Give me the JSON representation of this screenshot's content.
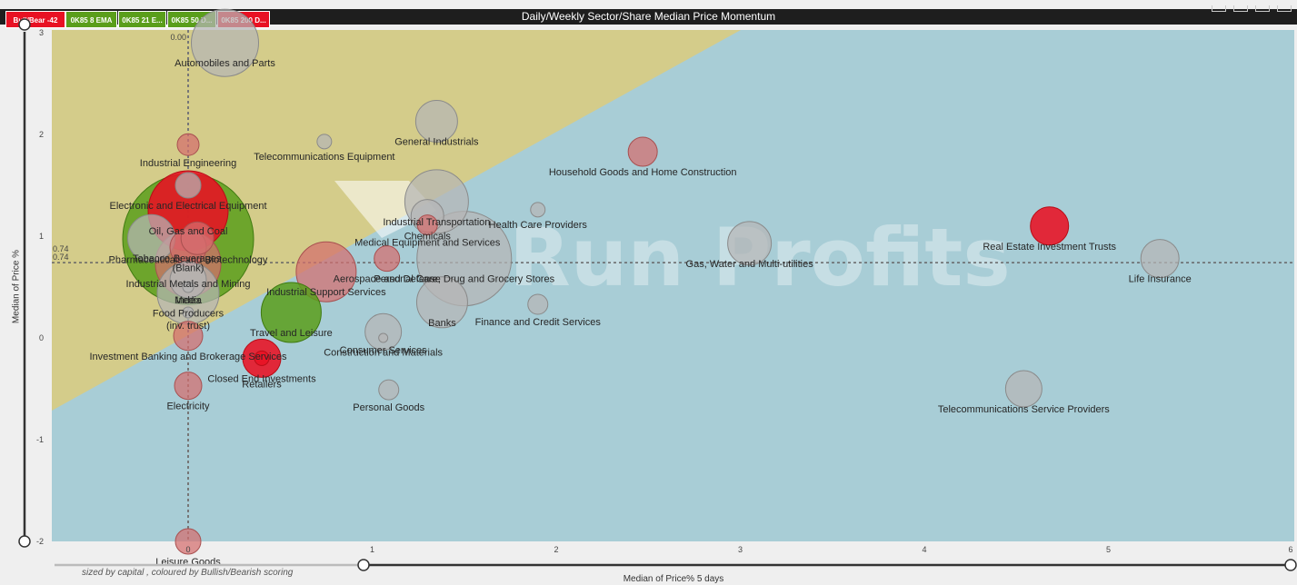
{
  "title": "Daily/Weekly Sector/Share Median Price Momentum",
  "badges": [
    {
      "label": "Bull/Bear -42",
      "color": "#e81123"
    },
    {
      "label": "0K85 8 EMA",
      "color": "#5a9e1b"
    },
    {
      "label": "0K85 21 E...",
      "color": "#5a9e1b"
    },
    {
      "label": "0K85 50 D...",
      "color": "#5a9e1b"
    },
    {
      "label": "0K85 200 D...",
      "color": "#e81123"
    }
  ],
  "caption": "sized by capital , coloured by Bullish/Bearish scoring",
  "watermark": "Run Profits",
  "colors": {
    "bullish": "#e81123",
    "bearish_fill": "#d46d6d",
    "neutral": "#b5b5b5",
    "green": "#5a9e1b",
    "bg_teal": "#a8cdd6",
    "bg_yellow": "#d4cc8a"
  },
  "chart_data": {
    "type": "scatter",
    "title": "Daily/Weekly Sector/Share Median Price Momentum",
    "xlabel": "Median of Price% 5 days",
    "ylabel": "Median of Price %",
    "xlim": [
      -0.7,
      6
    ],
    "ylim": [
      -2,
      3
    ],
    "xticks": [
      0,
      1,
      2,
      3,
      4,
      5,
      6
    ],
    "yticks": [
      -2,
      -1,
      0,
      1,
      2,
      3
    ],
    "reference_lines": {
      "x": 0,
      "y": 0.74,
      "y_labels": [
        "0.74",
        "0.74"
      ],
      "x_label": "0.00"
    },
    "grid": false,
    "points": [
      {
        "name": "Automobiles and Parts",
        "x": 0.2,
        "y": 2.9,
        "size": 37,
        "color": "grey"
      },
      {
        "name": "Industrial Engineering",
        "x": 0.0,
        "y": 1.9,
        "size": 12,
        "color": "red"
      },
      {
        "name": "Telecommunications Equipment",
        "x": 0.74,
        "y": 1.93,
        "size": 8,
        "color": "grey"
      },
      {
        "name": "General Industrials",
        "x": 1.35,
        "y": 2.13,
        "size": 23,
        "color": "grey"
      },
      {
        "name": "Household Goods and Home Construction",
        "x": 2.47,
        "y": 1.83,
        "size": 16,
        "color": "red"
      },
      {
        "name": "Electronic and Electrical Equipment",
        "x": 0.0,
        "y": 1.5,
        "size": 14,
        "color": "grey"
      },
      {
        "name": "Oil, Gas and Coal",
        "x": 0.0,
        "y": 1.25,
        "size": 44,
        "color": "bright-red"
      },
      {
        "name": "Industrial Transportation",
        "x": 1.35,
        "y": 1.34,
        "size": 35,
        "color": "grey"
      },
      {
        "name": "Chemicals",
        "x": 1.3,
        "y": 1.2,
        "size": 18,
        "color": "grey"
      },
      {
        "name": "Health Care Providers",
        "x": 1.9,
        "y": 1.26,
        "size": 8,
        "color": "grey"
      },
      {
        "name": "Pharmaceuticals and Biotechnology",
        "x": 0.0,
        "y": 0.97,
        "size": 72,
        "color": "green"
      },
      {
        "name": "Medical Equipment and Services",
        "x": 1.3,
        "y": 1.11,
        "size": 11,
        "color": "red"
      },
      {
        "name": "Tobacco",
        "x": -0.2,
        "y": 0.98,
        "size": 26,
        "color": "grey"
      },
      {
        "name": "Beverages",
        "x": 0.05,
        "y": 0.98,
        "size": 18,
        "color": "red"
      },
      {
        "name": "(Blank)",
        "x": 0.0,
        "y": 0.89,
        "size": 20,
        "color": "red"
      },
      {
        "name": "Gas, Water and Multi-utilities",
        "x": 3.05,
        "y": 0.93,
        "size": 24,
        "color": "grey"
      },
      {
        "name": "Real Estate Investment Trusts",
        "x": 4.68,
        "y": 1.1,
        "size": 21,
        "color": "bright-red"
      },
      {
        "name": "Personal Care, Drug and Grocery Stores",
        "x": 1.5,
        "y": 0.78,
        "size": 52,
        "color": "grey"
      },
      {
        "name": "Industrial Metals and Mining",
        "x": 0.0,
        "y": 0.73,
        "size": 36,
        "color": "red"
      },
      {
        "name": "Aerospace and Defense",
        "x": 1.08,
        "y": 0.78,
        "size": 14,
        "color": "red"
      },
      {
        "name": "Life Insurance",
        "x": 5.28,
        "y": 0.78,
        "size": 21,
        "color": "grey"
      },
      {
        "name": "Industrial Support Services",
        "x": 0.75,
        "y": 0.65,
        "size": 33,
        "color": "red"
      },
      {
        "name": "Media",
        "x": 0.0,
        "y": 0.57,
        "size": 20,
        "color": "grey"
      },
      {
        "name": "Index",
        "x": 0.0,
        "y": 0.5,
        "size": 6,
        "color": "grey"
      },
      {
        "name": "Finance and Credit Services",
        "x": 1.9,
        "y": 0.33,
        "size": 11,
        "color": "grey"
      },
      {
        "name": "Food Producers",
        "x": 0.0,
        "y": 0.44,
        "size": 34,
        "color": "grey"
      },
      {
        "name": "Banks",
        "x": 1.38,
        "y": 0.35,
        "size": 28,
        "color": "grey"
      },
      {
        "name": "(inv. trust)",
        "x": 0.0,
        "y": 0.25,
        "size": 6,
        "color": "grey"
      },
      {
        "name": "Travel and Leisure",
        "x": 0.56,
        "y": 0.25,
        "size": 33,
        "color": "green"
      },
      {
        "name": "Construction and Materials",
        "x": 1.06,
        "y": 0.06,
        "size": 20,
        "color": "grey"
      },
      {
        "name": "Investment Banking and Brokerage Services",
        "x": 0.0,
        "y": 0.02,
        "size": 16,
        "color": "red"
      },
      {
        "name": "Consumer Services",
        "x": 1.06,
        "y": 0.0,
        "size": 5,
        "color": "grey"
      },
      {
        "name": "Closed End Investments",
        "x": 0.4,
        "y": -0.2,
        "size": 21,
        "color": "bright-red"
      },
      {
        "name": "Retailers",
        "x": 0.4,
        "y": -0.2,
        "size": 8,
        "color": "bright-red"
      },
      {
        "name": "Electricity",
        "x": 0.0,
        "y": -0.47,
        "size": 15,
        "color": "red"
      },
      {
        "name": "Personal Goods",
        "x": 1.09,
        "y": -0.51,
        "size": 11,
        "color": "grey"
      },
      {
        "name": "Telecommunications Service Providers",
        "x": 4.54,
        "y": -0.5,
        "size": 20,
        "color": "grey"
      },
      {
        "name": "Leisure Goods",
        "x": 0.0,
        "y": -2.0,
        "size": 14,
        "color": "red"
      }
    ]
  }
}
